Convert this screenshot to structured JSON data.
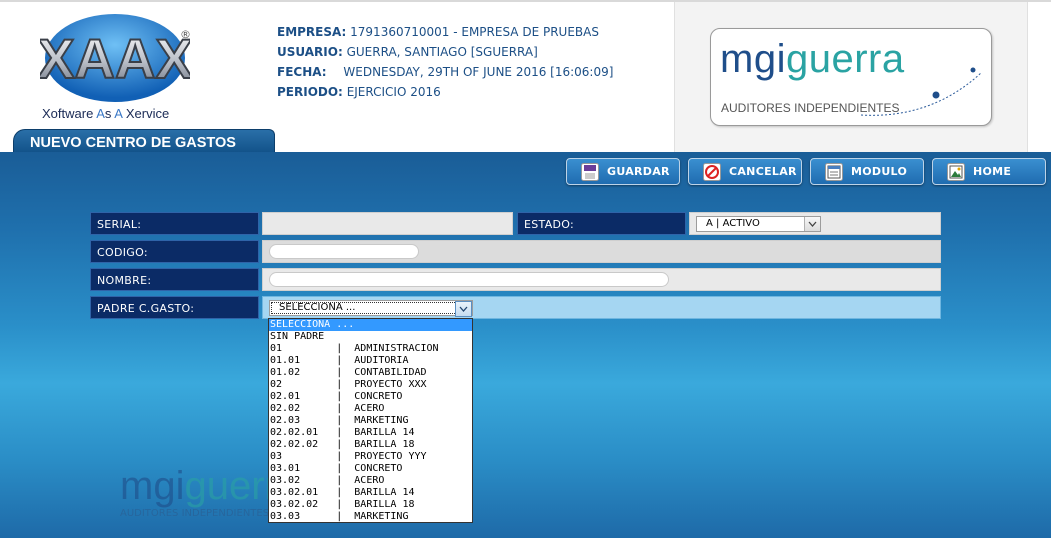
{
  "header": {
    "logo_text": "XAAX",
    "logo_tagline": [
      "X",
      "oftware ",
      "A",
      "s ",
      "A",
      " X",
      "ervice"
    ],
    "registered_mark": "®",
    "info": [
      {
        "label": "EMPRESA:",
        "value": "1791360710001 - EMPRESA DE PRUEBAS"
      },
      {
        "label": "USUARIO:",
        "value": "GUERRA, SANTIAGO [SGUERRA]"
      },
      {
        "label": "FECHA:",
        "value": "WEDNESDAY, 29TH OF JUNE 2016 [16:06:09]"
      },
      {
        "label": "PERIODO:",
        "value": "EJERCICIO 2016"
      }
    ],
    "brand": {
      "part1": "mgi",
      "part2": "guerra",
      "subtitle": "AUDITORES INDEPENDIENTES"
    },
    "page_tab": "NUEVO CENTRO DE GASTOS"
  },
  "toolbar": {
    "buttons": [
      {
        "label": "GUARDAR",
        "icon": "floppy-disk-icon"
      },
      {
        "label": "CANCELAR",
        "icon": "cancel-icon"
      },
      {
        "label": "MODULO",
        "icon": "window-icon"
      },
      {
        "label": "HOME",
        "icon": "home-picture-icon"
      }
    ]
  },
  "form": {
    "serial_label": "SERIAL:",
    "estado_label": "ESTADO:",
    "estado_value": "A | ACTIVO",
    "codigo_label": "CODIGO:",
    "nombre_label": "NOMBRE:",
    "padre_label": "PADRE C.GASTO:",
    "padre_value": "SELECCIONA ..."
  },
  "dropdown_options": [
    "SELECCIONA ...",
    "SIN PADRE",
    "01         |  ADMINISTRACION",
    "01.01      |  AUDITORIA",
    "01.02      |  CONTABILIDAD",
    "02         |  PROYECTO XXX",
    "02.01      |  CONCRETO",
    "02.02      |  ACERO",
    "02.03      |  MARKETING",
    "02.02.01   |  BARILLA 14",
    "02.02.02   |  BARILLA 18",
    "03         |  PROYECTO YYY",
    "03.01      |  CONCRETO",
    "03.02      |  ACERO",
    "03.02.01   |  BARILLA 14",
    "03.02.02   |  BARILLA 18",
    "03.03      |  MARKETING"
  ],
  "background_brand": {
    "part1": "mgi",
    "part2": "guerra",
    "subtitle": "AUDITORES INDEPENDIENTES"
  },
  "colors": {
    "accent": "#1f6cb0",
    "label_bg": "#0b2b66",
    "selected_option": "#3399ff"
  }
}
